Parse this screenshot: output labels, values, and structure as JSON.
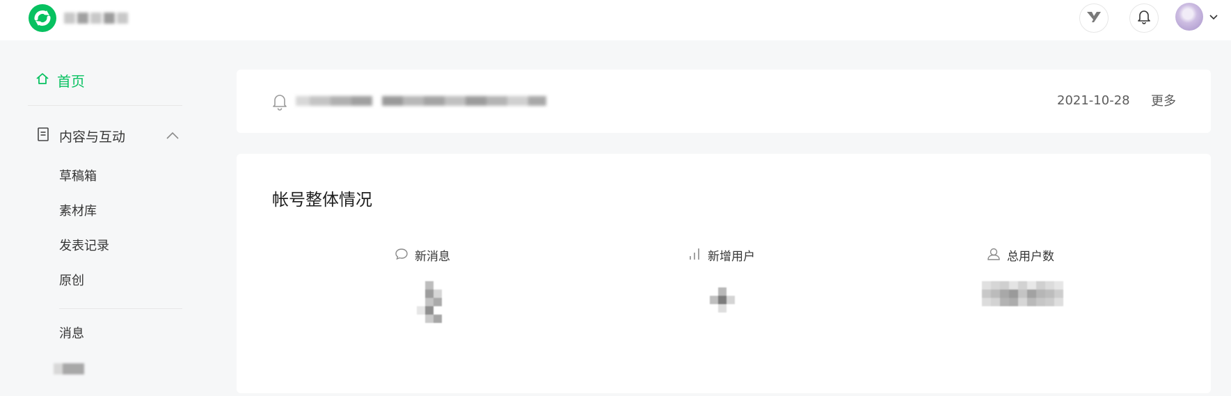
{
  "sidebar": {
    "home": "首页",
    "content_group": "内容与互动",
    "content_items": [
      "草稿箱",
      "素材库",
      "发表记录",
      "原创"
    ],
    "messages": "消息"
  },
  "notice": {
    "date": "2021-10-28",
    "more": "更多"
  },
  "overview": {
    "title": "帐号整体情况",
    "stats": [
      {
        "label": "新消息",
        "icon": "chat-bubble-icon"
      },
      {
        "label": "新增用户",
        "icon": "bar-chart-icon"
      },
      {
        "label": "总用户数",
        "icon": "user-icon"
      }
    ]
  },
  "colors": {
    "accent": "#07c160",
    "page_bg": "#f6f7f8",
    "card_bg": "#ffffff",
    "text": "#353535",
    "muted": "#5c5c5c"
  }
}
